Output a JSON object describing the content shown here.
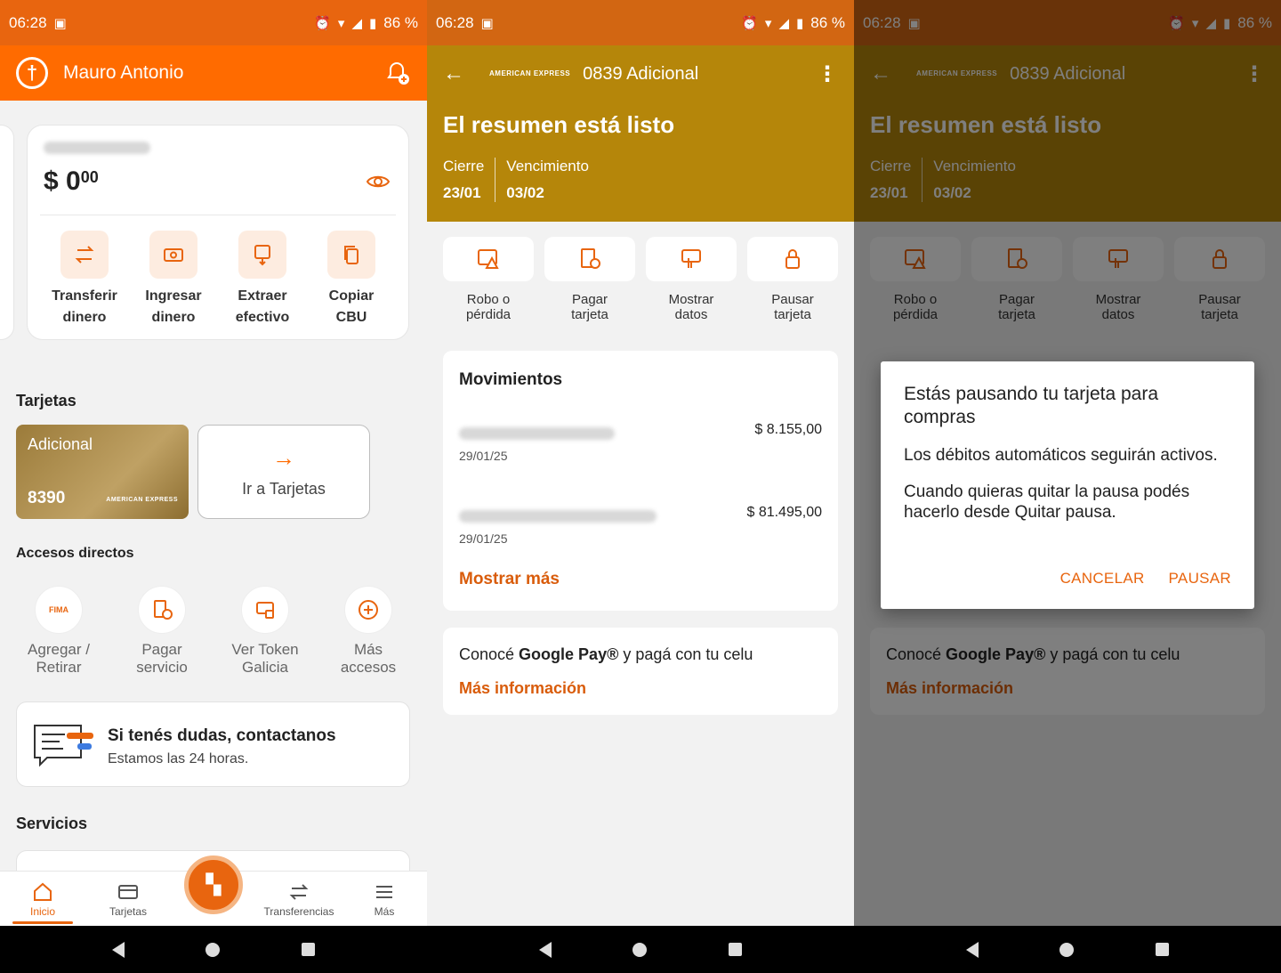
{
  "status_bar": {
    "time": "06:28",
    "battery": "86 %"
  },
  "screen1": {
    "header": {
      "user_name": "Mauro Antonio"
    },
    "account": {
      "balance_symbol": "$",
      "balance_int": "0",
      "balance_dec": "00",
      "actions": [
        {
          "label": "Transferir\ndinero",
          "icon": "transfer-icon"
        },
        {
          "label": "Ingresar\ndinero",
          "icon": "deposit-icon"
        },
        {
          "label": "Extraer\nefectivo",
          "icon": "withdraw-icon"
        },
        {
          "label": "Copiar\nCBU",
          "icon": "copy-icon"
        }
      ]
    },
    "cards_section": {
      "title": "Tarjetas",
      "card": {
        "label": "Adicional",
        "last_digits": "8390",
        "brand": "AMERICAN EXPRESS"
      },
      "go_to_cards": "Ir a Tarjetas"
    },
    "shortcuts": {
      "title": "Accesos directos",
      "items": [
        {
          "label": "Agregar /\nRetirar",
          "badge": "FIMA"
        },
        {
          "label": "Pagar\nservicio"
        },
        {
          "label": "Ver Token\nGalicia"
        },
        {
          "label": "Más\naccesos"
        }
      ]
    },
    "help": {
      "title": "Si tenés dudas, contactanos",
      "subtitle": "Estamos las 24 horas."
    },
    "services_title": "Servicios",
    "nav": [
      {
        "label": "Inicio"
      },
      {
        "label": "Tarjetas"
      },
      {
        "label": "Transferencias"
      },
      {
        "label": "Más"
      }
    ]
  },
  "screen2": {
    "header": {
      "brand": "AMERICAN EXPRESS",
      "card_name": "0839 Adicional",
      "title": "El resumen está listo",
      "closing_label": "Cierre",
      "closing_date": "23/01",
      "due_label": "Vencimiento",
      "due_date": "03/02"
    },
    "quick_actions": [
      {
        "label": "Robo o\npérdida"
      },
      {
        "label": "Pagar\ntarjeta"
      },
      {
        "label": "Mostrar\ndatos"
      },
      {
        "label": "Pausar\ntarjeta"
      }
    ],
    "movements": {
      "title": "Movimientos",
      "rows": [
        {
          "amount": "$ 8.155,00",
          "date": "29/01/25"
        },
        {
          "amount": "$ 81.495,00",
          "date": "29/01/25"
        }
      ],
      "more": "Mostrar más"
    },
    "gpay": {
      "text_pre": "Conocé ",
      "text_bold": "Google Pay®",
      "text_post": " y pagá con tu celu",
      "link": "Más información"
    }
  },
  "dialog": {
    "title": "Estás pausando tu tarjeta para compras",
    "p1": "Los débitos automáticos seguirán activos.",
    "p2": "Cuando quieras quitar la pausa podés hacerlo desde Quitar pausa.",
    "cancel": "CANCELAR",
    "confirm": "PAUSAR"
  },
  "colors": {
    "orange": "#ff6b00",
    "gold": "#b5860a",
    "accent": "#e8650f"
  }
}
